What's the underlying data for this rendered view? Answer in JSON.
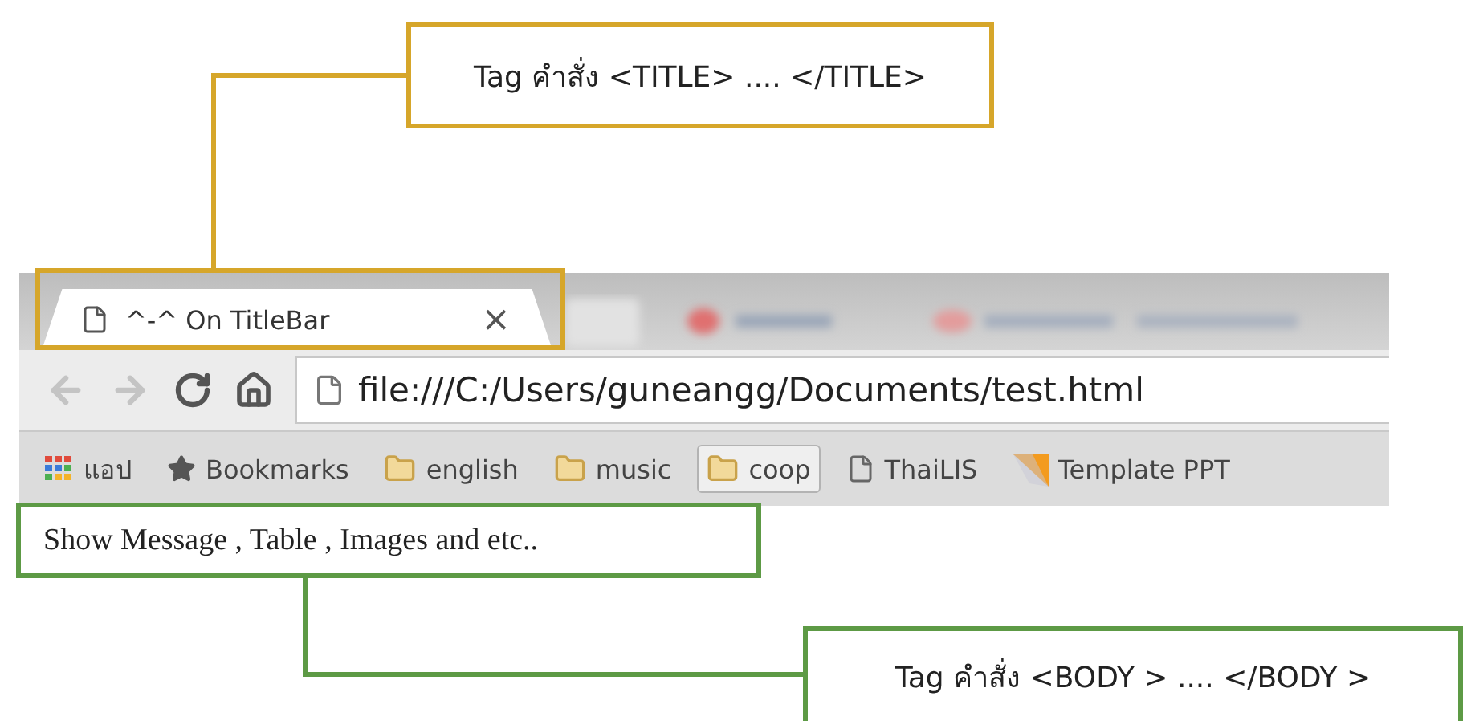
{
  "title_callout": {
    "text": "Tag คำสั่ง <TITLE> .... </TITLE>"
  },
  "browser": {
    "tab": {
      "title": "^-^ On TitleBar",
      "close": "×"
    },
    "address": "file:///C:/Users/guneangg/Documents/test.html",
    "bookmarks": [
      {
        "kind": "apps",
        "label": "แอป",
        "selected": false
      },
      {
        "kind": "star",
        "label": "Bookmarks",
        "selected": false
      },
      {
        "kind": "folder",
        "label": "english",
        "selected": false
      },
      {
        "kind": "folder",
        "label": "music",
        "selected": false
      },
      {
        "kind": "folder",
        "label": "coop",
        "selected": true
      },
      {
        "kind": "page",
        "label": "ThaiLIS",
        "selected": false
      },
      {
        "kind": "ppt",
        "label": "Template PPT",
        "selected": false
      }
    ]
  },
  "page_body": {
    "text": "Show Message , Table , Images and etc.."
  },
  "body_callout": {
    "text": "Tag คำสั่ง <BODY > .... </BODY >"
  }
}
